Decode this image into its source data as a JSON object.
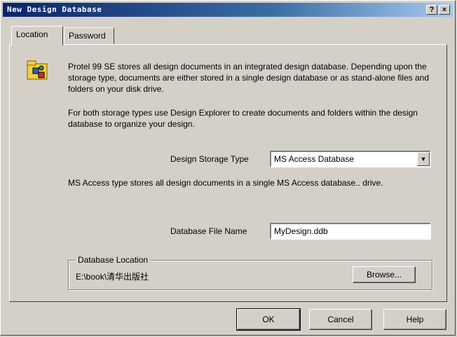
{
  "window": {
    "title": "New Design Database",
    "help_glyph": "?",
    "close_glyph": "×"
  },
  "tabs": [
    {
      "label": "Location",
      "active": true
    },
    {
      "label": "Password",
      "active": false
    }
  ],
  "location": {
    "icon": "design-database-icon",
    "intro": "Protel 99 SE stores all design documents in an integrated design database. Depending upon the storage type, documents are either stored in a single design database or as stand-alone files and folders on your disk drive.",
    "explorer_note": "For both storage types use Design Explorer to create documents and folders within the design database to organize your design.",
    "storage_type_label": "Design Storage Type",
    "storage_type_value": "MS Access Database",
    "storage_type_desc": "MS Access type stores all design documents in a single MS Access database.. drive.",
    "file_name_label": "Database File Name",
    "file_name_value": "MyDesign.ddb",
    "location_group_label": "Database Location",
    "location_path": "E:\\book\\清华出版社",
    "browse_label": "Browse..."
  },
  "buttons": {
    "ok": "OK",
    "cancel": "Cancel",
    "help": "Help"
  },
  "colors": {
    "face": "#d4d0c8",
    "title_start": "#0a246a",
    "title_end": "#a6caf0"
  }
}
